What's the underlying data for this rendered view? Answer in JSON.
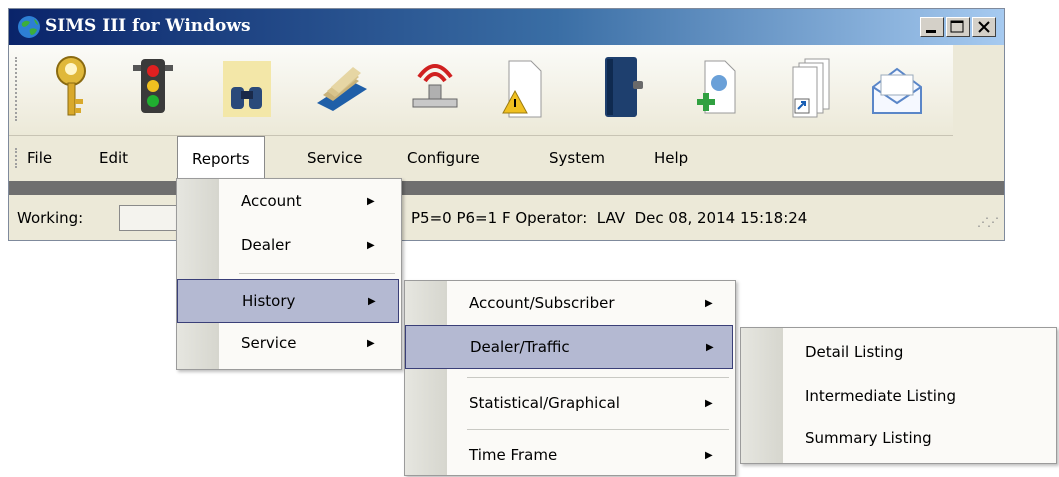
{
  "window": {
    "title": "SIMS III for Windows",
    "controls": [
      "minimize",
      "maximize",
      "close"
    ]
  },
  "toolbar": {
    "icons": [
      "key-icon",
      "traffic-light-icon",
      "binoculars-icon",
      "card-file-icon",
      "alarm-signal-icon",
      "warning-document-icon",
      "address-book-icon",
      "add-document-icon",
      "documents-shortcut-icon",
      "envelope-icon"
    ]
  },
  "menubar": {
    "items": [
      "File",
      "Edit",
      "Reports",
      "Service",
      "Configure",
      "System",
      "Help"
    ],
    "active": "Reports"
  },
  "status": {
    "label": "Working:",
    "text": "P5=0 P6=1 F Operator:  LAV  Dec 08, 2014 15:18:24"
  },
  "reports_menu": {
    "items": [
      "Account",
      "Dealer",
      "History",
      "Service"
    ],
    "selected": "History"
  },
  "history_menu": {
    "items": [
      "Account/Subscriber",
      "Dealer/Traffic",
      "Statistical/Graphical",
      "Time Frame"
    ],
    "selected": "Dealer/Traffic"
  },
  "dealer_traffic_menu": {
    "items": [
      "Detail Listing",
      "Intermediate Listing",
      "Summary Listing"
    ]
  },
  "colors": {
    "titlebar_start": "#0a246a",
    "menu_selection": "#b4b9d2",
    "menu_selection_border": "#3a3f78"
  }
}
